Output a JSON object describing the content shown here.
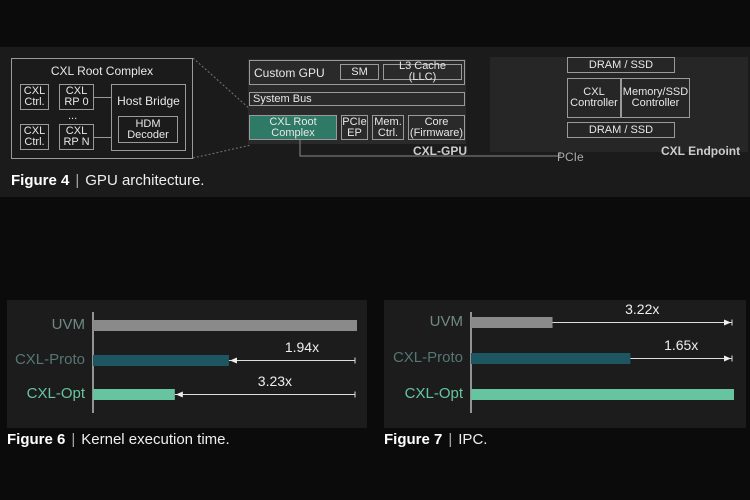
{
  "figure4": {
    "root_complex": {
      "title": "CXL Root Complex",
      "ctrl1": "CXL Ctrl.",
      "rp0": "CXL RP 0",
      "ellipsis": "...",
      "ctrl2": "CXL Ctrl.",
      "rpn": "CXL RP N",
      "host_bridge": "Host Bridge",
      "hdm": "HDM Decoder"
    },
    "gpu": {
      "custom_gpu": "Custom GPU",
      "sm": "SM",
      "l3": "L3 Cache (LLC)",
      "system_bus": "System Bus",
      "cxl_rc": "CXL Root Complex",
      "pcie_ep": "PCIe EP",
      "mem_ctrl": "Mem. Ctrl.",
      "core": "Core (Firmware)",
      "label": "CXL-GPU"
    },
    "endpoint": {
      "dram_top": "DRAM / SSD",
      "cxl_controller": "CXL Controller",
      "mem_controller": "Memory/SSD Controller",
      "dram_bottom": "DRAM / SSD",
      "label": "CXL Endpoint",
      "pcie": "PCIe"
    },
    "caption": {
      "num": "Figure 4",
      "text": "GPU architecture."
    }
  },
  "colors": {
    "uvm": "#8a8a8a",
    "cxl_proto": "#1d5561",
    "cxl_opt": "#67c4a0",
    "rc_green": "#2f7a66"
  },
  "chart_data": [
    {
      "type": "bar",
      "orientation": "horizontal",
      "title": "",
      "caption_num": "Figure 6",
      "caption_text": "Kernel execution time.",
      "categories": [
        "UVM",
        "CXL-Proto",
        "CXL-Opt"
      ],
      "values": [
        1.0,
        0.515,
        0.31
      ],
      "annotations": [
        {
          "from": "CXL-Proto",
          "to": "UVM",
          "text": "1.94x"
        },
        {
          "from": "CXL-Opt",
          "to": "UVM",
          "text": "3.23x"
        }
      ],
      "xlim": [
        0,
        1
      ],
      "grid": false,
      "legend": "none"
    },
    {
      "type": "bar",
      "orientation": "horizontal",
      "title": "",
      "caption_num": "Figure 7",
      "caption_text": "IPC.",
      "categories": [
        "UVM",
        "CXL-Proto",
        "CXL-Opt"
      ],
      "values": [
        0.31,
        0.606,
        1.0
      ],
      "annotations": [
        {
          "from": "UVM",
          "to": "CXL-Opt",
          "text": "3.22x"
        },
        {
          "from": "CXL-Proto",
          "to": "CXL-Opt",
          "text": "1.65x"
        }
      ],
      "xlim": [
        0,
        1
      ],
      "grid": false,
      "legend": "none"
    }
  ],
  "sep": "|"
}
